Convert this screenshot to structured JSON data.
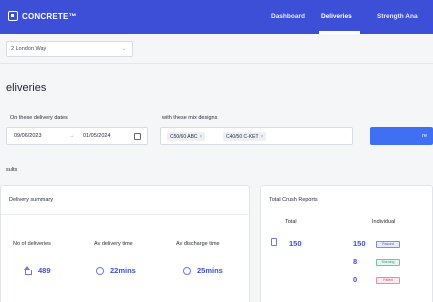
{
  "app": {
    "brand": "CONCRETE™"
  },
  "nav": {
    "items": [
      {
        "label": "Dashboard"
      },
      {
        "label": "Deliveries"
      },
      {
        "label": "Strength Ana"
      }
    ],
    "active": "Deliveries"
  },
  "location": {
    "value": "2 London Way"
  },
  "page": {
    "title": "eliveries"
  },
  "filters": {
    "dates_label": "On these delivery dates",
    "date_from": "09/06/2023",
    "date_sep": "→",
    "date_to": "01/05/2024",
    "mix_label": "with these mix designs",
    "mix_chips": [
      "C50/60 ABC",
      "C40/50 C-KET"
    ],
    "search_label": "re"
  },
  "results": {
    "label": "sults"
  },
  "delivery_summary": {
    "title": "Delivery summary",
    "no_label": "No of deliveries",
    "no_value": "489",
    "delivery_time_label": "Av delivery time",
    "delivery_time_value": "22mins",
    "discharge_time_label": "Av discharge time",
    "discharge_time_value": "25mins"
  },
  "crush_reports": {
    "title": "Total Crush Reports",
    "total_label": "Total",
    "individual_label": "Individual",
    "total_value": "150",
    "passed_value": "150",
    "warning_value": "8",
    "failed_value": "0",
    "passed_badge": "Passed",
    "warning_badge": "Warning",
    "failed_badge": "Failed"
  },
  "colors": {
    "nav_bg": "#3d4fd6",
    "accent": "#3f6ff2",
    "value_text": "#3d4fd6"
  },
  "icons": [
    "calendar-icon",
    "house-icon",
    "clock-icon",
    "document-icon",
    "chevron-down-icon"
  ]
}
